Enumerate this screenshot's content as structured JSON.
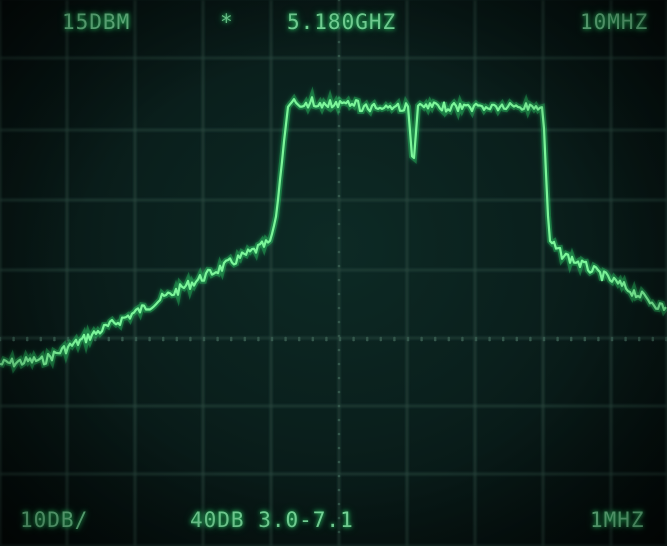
{
  "display": {
    "top_left": "15DBM",
    "marker_symbol": "*",
    "center_frequency": "5.180GHZ",
    "span_per_div": "10MHZ",
    "scale": "10DB/",
    "attenuation_range": "40DB 3.0-7.1",
    "resolution_bandwidth": "1MHZ"
  },
  "colors": {
    "trace": "#5cf07a",
    "graticule": "#2a4a40",
    "text": "#7fe6a4",
    "background": "#0a1f1c"
  }
}
